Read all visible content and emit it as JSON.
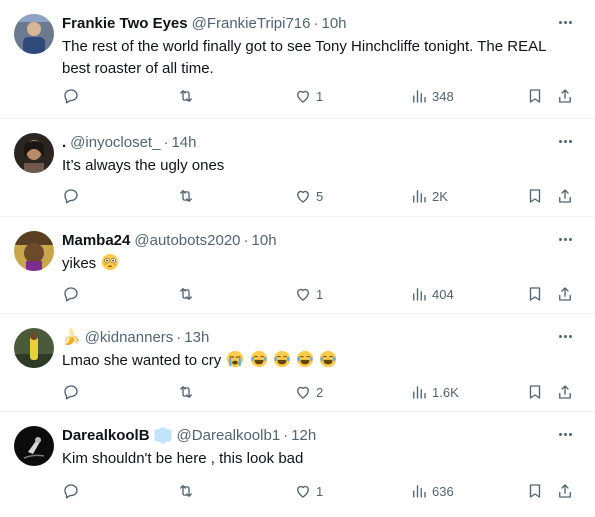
{
  "tweets": [
    {
      "name": "Frankie Two Eyes",
      "handle": "@FrankieTripi716",
      "time": "10h",
      "text": "The rest of the world finally got to see Tony Hinchcliffe tonight. The REAL best roaster of all time.",
      "replies": "",
      "retweets": "",
      "likes": "1",
      "views": "348"
    },
    {
      "name": ".",
      "handle": "@inyocloset_",
      "time": "14h",
      "text": "It’s always the ugly ones",
      "replies": "",
      "retweets": "",
      "likes": "5",
      "views": "2K"
    },
    {
      "name": "Mamba24",
      "handle": "@autobots2020",
      "time": "10h",
      "text": "yikes",
      "replies": "",
      "retweets": "",
      "likes": "1",
      "views": "404"
    },
    {
      "name": "🍌",
      "handle": "@kidnanners",
      "time": "13h",
      "text": "Lmao she wanted to cry",
      "replies": "",
      "retweets": "",
      "likes": "2",
      "views": "1.6K"
    },
    {
      "name": "DarealkoolB",
      "handle": "@Darealkoolb1",
      "time": "12h",
      "text": "Kim shouldn't be here , this look bad",
      "replies": "",
      "retweets": "",
      "likes": "1",
      "views": "636"
    }
  ],
  "colors": {
    "text_primary": "#0f1419",
    "text_secondary": "#536471",
    "divider": "#eff3f4",
    "verified_badge": "#1d9bf0",
    "emoji_yellow": "#ffcc4d"
  },
  "icons": [
    "reply-icon",
    "retweet-icon",
    "like-icon",
    "views-icon",
    "bookmark-icon",
    "share-icon",
    "more-icon",
    "verified-badge-icon"
  ]
}
